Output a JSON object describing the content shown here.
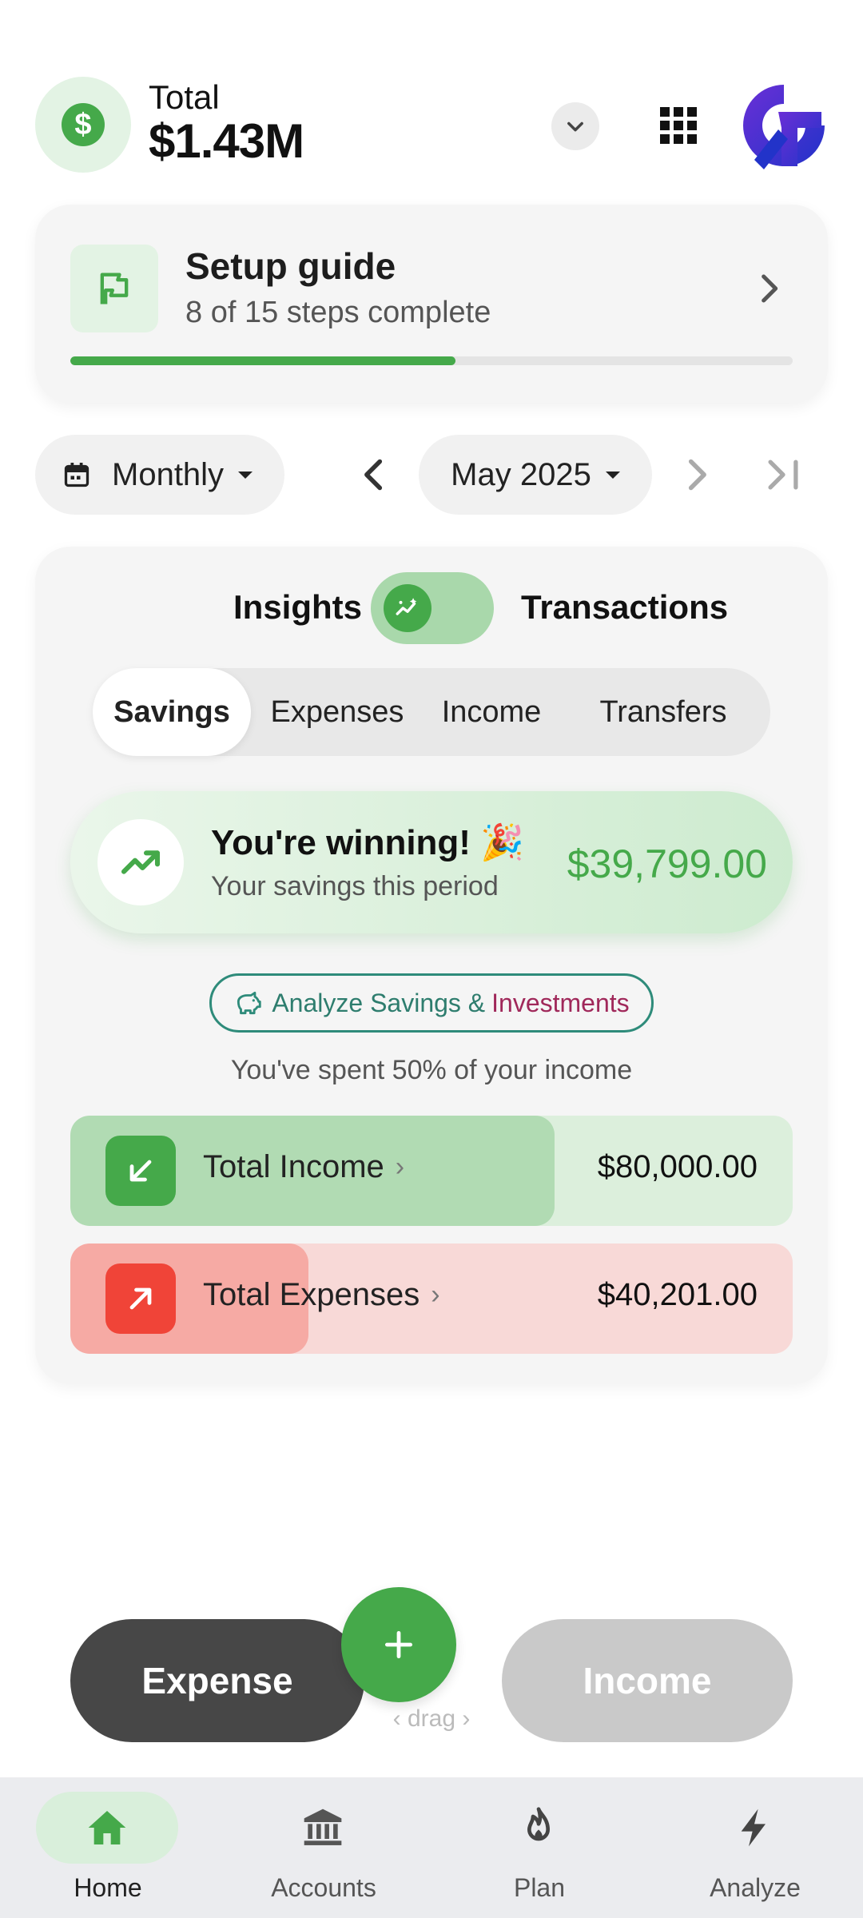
{
  "header": {
    "total_label": "Total",
    "total_value": "$1.43M",
    "total_icon": "dollar-icon",
    "currency_symbol": "$",
    "dropdown_icon": "chevron-down-icon",
    "apps_icon": "apps-grid-icon",
    "logo": "brand-logo"
  },
  "setup_guide": {
    "title": "Setup guide",
    "subtitle": "8 of 15 steps complete",
    "steps_done": 8,
    "steps_total": 15,
    "icon": "flag-icon"
  },
  "period": {
    "frequency_label": "Monthly",
    "month_label": "May 2025",
    "calendar_icon": "calendar-icon"
  },
  "view_switch": {
    "left_label": "Insights",
    "right_label": "Transactions",
    "state": "insights"
  },
  "tabs": [
    {
      "label": "Savings",
      "active": true
    },
    {
      "label": "Expenses",
      "active": false
    },
    {
      "label": "Income",
      "active": false
    },
    {
      "label": "Transfers",
      "active": false
    }
  ],
  "savings_card": {
    "title": "You're winning! 🎉",
    "subtitle": "Your savings this period",
    "amount": "$39,799.00"
  },
  "analyze_button": {
    "label_part1": "Analyze Savings &",
    "label_part2": "Investments"
  },
  "spent_text": "You've spent 50% of your income",
  "income_row": {
    "label": "Total Income",
    "amount": "$80,000.00",
    "fill_fraction": 0.67
  },
  "expense_row": {
    "label": "Total Expenses",
    "amount": "$40,201.00",
    "fill_fraction": 0.33
  },
  "actions": {
    "expense_label": "Expense",
    "income_label": "Income",
    "drag_hint": "drag"
  },
  "bottom_nav": [
    {
      "label": "Home",
      "icon": "home-icon",
      "active": true
    },
    {
      "label": "Accounts",
      "icon": "bank-icon",
      "active": false
    },
    {
      "label": "Plan",
      "icon": "flame-icon",
      "active": false
    },
    {
      "label": "Analyze",
      "icon": "lightning-icon",
      "active": false
    }
  ],
  "colors": {
    "accent_green": "#45a94a",
    "expense_red": "#f04438",
    "income_bar": "#b1dbb3",
    "expense_bar": "#f6aaa4"
  }
}
